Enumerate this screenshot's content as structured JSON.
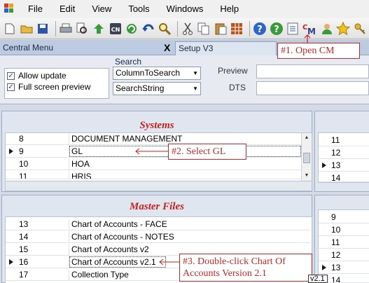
{
  "menu": {
    "items": [
      "File",
      "Edit",
      "View",
      "Tools",
      "Windows",
      "Help"
    ]
  },
  "toolbar": {
    "icons": [
      "new-document-icon",
      "open-folder-icon",
      "save-icon",
      "print-icon",
      "print-preview-icon",
      "upload-icon",
      "cn-icon",
      "refresh-icon",
      "undo-icon",
      "search-icon",
      "cut-icon",
      "copy-icon",
      "paste-icon",
      "grid-icon",
      "help-icon",
      "question-icon",
      "notes-icon",
      "cm-icon",
      "user-icon",
      "star-icon",
      "key-icon"
    ],
    "cm_label": "CM"
  },
  "tabs": {
    "central_menu": "Central Menu",
    "close": "X",
    "setup": "Setup V3"
  },
  "options": {
    "allow_update": "Allow update",
    "full_screen_preview": "Full screen preview",
    "search_label": "Search",
    "column_to_search": "ColumnToSearch",
    "search_string": "SearchString",
    "preview_label": "Preview",
    "dts_label": "DTS"
  },
  "systems": {
    "title": "Systems",
    "rows": [
      {
        "id": "8",
        "name": "DOCUMENT MANAGEMENT"
      },
      {
        "id": "9",
        "name": "GL"
      },
      {
        "id": "10",
        "name": "HOA"
      },
      {
        "id": "11",
        "name": "HRIS"
      }
    ],
    "side_rows": [
      "11",
      "12",
      "13",
      "14"
    ]
  },
  "master_files": {
    "title": "Master Files",
    "rows": [
      {
        "id": "13",
        "name": "Chart of Accounts - FACE"
      },
      {
        "id": "14",
        "name": "Chart of Accounts - NOTES"
      },
      {
        "id": "15",
        "name": "Chart of Accounts v2"
      },
      {
        "id": "16",
        "name": "Chart of Accounts v2.1"
      },
      {
        "id": "17",
        "name": "Collection Type"
      }
    ],
    "side_rows": [
      "9",
      "10",
      "11",
      "12",
      "13",
      "14"
    ]
  },
  "callouts": {
    "open_cm": "#1. Open CM",
    "select_gl": "#2. Select GL",
    "double_click_line1": "#3. Double-click Chart Of",
    "double_click_line2": "Accounts Version 2.1",
    "tooltip": "v2.1"
  },
  "colors": {
    "accent": "#c4211f",
    "panel": "#dfe6f0",
    "tab_bar": "#bccbe0"
  }
}
